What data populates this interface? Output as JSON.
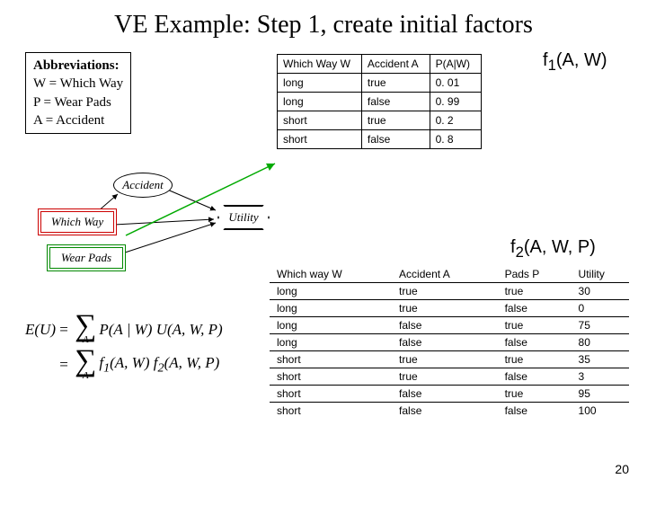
{
  "title": "VE Example: Step 1, create initial factors",
  "abbrev": {
    "heading": "Abbreviations:",
    "l1": "W = Which Way",
    "l2": "P  = Wear Pads",
    "l3": "A  = Accident"
  },
  "f1_label": "f",
  "f1_sub": "1",
  "f1_args": "(A, W)",
  "t1": {
    "h1": "Which Way W",
    "h2": "Accident A",
    "h3": "P(A|W)",
    "rows": [
      {
        "c1": "long",
        "c2": "true",
        "c3": "0. 01"
      },
      {
        "c1": "long",
        "c2": "false",
        "c3": "0. 99"
      },
      {
        "c1": "short",
        "c2": "true",
        "c3": "0. 2"
      },
      {
        "c1": "short",
        "c2": "false",
        "c3": "0. 8"
      }
    ]
  },
  "diagram": {
    "accident": "Accident",
    "whichway": "Which Way",
    "wearpads": "Wear Pads",
    "utility": "Utility"
  },
  "f2_label": "f",
  "f2_sub": "2",
  "f2_args": "(A, W, P)",
  "t2": {
    "h1": "Which way W",
    "h2": "Accident A",
    "h3": "Pads P",
    "h4": "Utility",
    "rows": [
      {
        "c1": "long",
        "c2": "true",
        "c3": "true",
        "c4": "30"
      },
      {
        "c1": "long",
        "c2": "true",
        "c3": "false",
        "c4": "0"
      },
      {
        "c1": "long",
        "c2": "false",
        "c3": "true",
        "c4": "75"
      },
      {
        "c1": "long",
        "c2": "false",
        "c3": "false",
        "c4": "80"
      },
      {
        "c1": "short",
        "c2": "true",
        "c3": "true",
        "c4": "35"
      },
      {
        "c1": "short",
        "c2": "true",
        "c3": "false",
        "c4": "3"
      },
      {
        "c1": "short",
        "c2": "false",
        "c3": "true",
        "c4": "95"
      },
      {
        "c1": "short",
        "c2": "false",
        "c3": "false",
        "c4": "100"
      }
    ]
  },
  "formula": {
    "lhs": "E(U)",
    "eq": "=",
    "r1a": "P(A | W) U(A, W, P)",
    "r2a": "f",
    "r2a_sub": "1",
    "r2a_args": "(A, W)",
    "r2b": " f",
    "r2b_sub": "2",
    "r2b_args": "(A, W, P)",
    "sigmaA": "A"
  },
  "pagenum": "20"
}
